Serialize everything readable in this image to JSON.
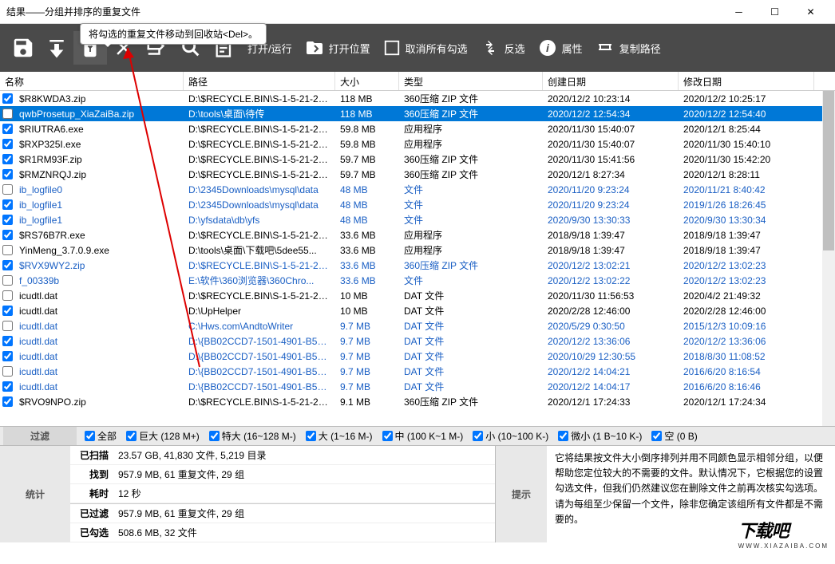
{
  "window": {
    "title": "结果——分组并排序的重复文件"
  },
  "tooltip": "将勾选的重复文件移动到回收站<Del>。",
  "toolbar": {
    "open_run": "打开/运行",
    "open_location": "打开位置",
    "deselect_all": "取消所有勾选",
    "invert": "反选",
    "properties": "属性",
    "copy_path": "复制路径"
  },
  "columns": {
    "name": "名称",
    "path": "路径",
    "size": "大小",
    "type": "类型",
    "created": "创建日期",
    "modified": "修改日期"
  },
  "rows": [
    {
      "chk": true,
      "cls": "black",
      "name": "$R8KWDA3.zip",
      "path": "D:\\$RECYCLE.BIN\\S-1-5-21-21...",
      "size": "118 MB",
      "type": "360压缩 ZIP 文件",
      "created": "2020/12/2 10:23:14",
      "modified": "2020/12/2 10:25:17"
    },
    {
      "chk": false,
      "sel": true,
      "cls": "blue",
      "name": "qwbProsetup_XiaZaiBa.zip",
      "path": "D:\\tools\\桌面\\待传",
      "size": "118 MB",
      "type": "360压缩 ZIP 文件",
      "created": "2020/12/2 12:54:34",
      "modified": "2020/12/2 12:54:40"
    },
    {
      "chk": true,
      "cls": "black",
      "name": "$RIUTRA6.exe",
      "path": "D:\\$RECYCLE.BIN\\S-1-5-21-21...",
      "size": "59.8 MB",
      "type": "应用程序",
      "created": "2020/11/30 15:40:07",
      "modified": "2020/12/1 8:25:44"
    },
    {
      "chk": true,
      "cls": "black",
      "name": "$RXP325I.exe",
      "path": "D:\\$RECYCLE.BIN\\S-1-5-21-21...",
      "size": "59.8 MB",
      "type": "应用程序",
      "created": "2020/11/30 15:40:07",
      "modified": "2020/11/30 15:40:10"
    },
    {
      "chk": true,
      "cls": "black",
      "name": "$R1RM93F.zip",
      "path": "D:\\$RECYCLE.BIN\\S-1-5-21-21...",
      "size": "59.7 MB",
      "type": "360压缩 ZIP 文件",
      "created": "2020/11/30 15:41:56",
      "modified": "2020/11/30 15:42:20"
    },
    {
      "chk": true,
      "cls": "black",
      "name": "$RMZNRQJ.zip",
      "path": "D:\\$RECYCLE.BIN\\S-1-5-21-21...",
      "size": "59.7 MB",
      "type": "360压缩 ZIP 文件",
      "created": "2020/12/1 8:27:34",
      "modified": "2020/12/1 8:28:11"
    },
    {
      "chk": false,
      "cls": "blue",
      "name": "ib_logfile0",
      "path": "D:\\2345Downloads\\mysql\\data",
      "size": "48 MB",
      "type": "文件",
      "created": "2020/11/20 9:23:24",
      "modified": "2020/11/21 8:40:42"
    },
    {
      "chk": true,
      "cls": "blue",
      "name": "ib_logfile1",
      "path": "D:\\2345Downloads\\mysql\\data",
      "size": "48 MB",
      "type": "文件",
      "created": "2020/11/20 9:23:24",
      "modified": "2019/1/26 18:26:45"
    },
    {
      "chk": true,
      "cls": "blue",
      "name": "ib_logfile1",
      "path": "D:\\yfsdata\\db\\yfs",
      "size": "48 MB",
      "type": "文件",
      "created": "2020/9/30 13:30:33",
      "modified": "2020/9/30 13:30:34"
    },
    {
      "chk": true,
      "cls": "black",
      "name": "$RS76B7R.exe",
      "path": "D:\\$RECYCLE.BIN\\S-1-5-21-21...",
      "size": "33.6 MB",
      "type": "应用程序",
      "created": "2018/9/18 1:39:47",
      "modified": "2018/9/18 1:39:47"
    },
    {
      "chk": false,
      "cls": "black",
      "name": "YinMeng_3.7.0.9.exe",
      "path": "D:\\tools\\桌面\\下载吧\\5dee55...",
      "size": "33.6 MB",
      "type": "应用程序",
      "created": "2018/9/18 1:39:47",
      "modified": "2018/9/18 1:39:47"
    },
    {
      "chk": true,
      "cls": "blue",
      "name": "$RVX9WY2.zip",
      "path": "D:\\$RECYCLE.BIN\\S-1-5-21-21...",
      "size": "33.6 MB",
      "type": "360压缩 ZIP 文件",
      "created": "2020/12/2 13:02:21",
      "modified": "2020/12/2 13:02:23"
    },
    {
      "chk": false,
      "cls": "blue",
      "name": "f_00339b",
      "path": "E:\\软件\\360浏览器\\360Chro...",
      "size": "33.6 MB",
      "type": "文件",
      "created": "2020/12/2 13:02:22",
      "modified": "2020/12/2 13:02:23"
    },
    {
      "chk": false,
      "cls": "black",
      "name": "icudtl.dat",
      "path": "D:\\$RECYCLE.BIN\\S-1-5-21-21...",
      "size": "10 MB",
      "type": "DAT 文件",
      "created": "2020/11/30 11:56:53",
      "modified": "2020/4/2 21:49:32"
    },
    {
      "chk": true,
      "cls": "black",
      "name": "icudtl.dat",
      "path": "D:\\UpHelper",
      "size": "10 MB",
      "type": "DAT 文件",
      "created": "2020/2/28 12:46:00",
      "modified": "2020/2/28 12:46:00"
    },
    {
      "chk": false,
      "cls": "blue",
      "name": "icudtl.dat",
      "path": "C:\\Hws.com\\AndtoWriter",
      "size": "9.7 MB",
      "type": "DAT 文件",
      "created": "2020/5/29 0:30:50",
      "modified": "2015/12/3 10:09:16"
    },
    {
      "chk": true,
      "cls": "blue",
      "name": "icudtl.dat",
      "path": "D:\\{BB02CCD7-1501-4901-B5E...",
      "size": "9.7 MB",
      "type": "DAT 文件",
      "created": "2020/12/2 13:36:06",
      "modified": "2020/12/2 13:36:06"
    },
    {
      "chk": true,
      "cls": "blue",
      "name": "icudtl.dat",
      "path": "D:\\{BB02CCD7-1501-4901-B5E...",
      "size": "9.7 MB",
      "type": "DAT 文件",
      "created": "2020/10/29 12:30:55",
      "modified": "2018/8/30 11:08:52"
    },
    {
      "chk": false,
      "cls": "blue",
      "name": "icudtl.dat",
      "path": "D:\\{BB02CCD7-1501-4901-B5E...",
      "size": "9.7 MB",
      "type": "DAT 文件",
      "created": "2020/12/2 14:04:21",
      "modified": "2016/6/20 8:16:54"
    },
    {
      "chk": true,
      "cls": "blue",
      "name": "icudtl.dat",
      "path": "D:\\{BB02CCD7-1501-4901-B5E...",
      "size": "9.7 MB",
      "type": "DAT 文件",
      "created": "2020/12/2 14:04:17",
      "modified": "2016/6/20 8:16:46"
    },
    {
      "chk": true,
      "cls": "black",
      "name": "$RVO9NPO.zip",
      "path": "D:\\$RECYCLE.BIN\\S-1-5-21-21...",
      "size": "9.1 MB",
      "type": "360压缩 ZIP 文件",
      "created": "2020/12/1 17:24:33",
      "modified": "2020/12/1 17:24:34"
    }
  ],
  "filters": {
    "label": "过滤",
    "all": "全部",
    "huge": "巨大",
    "huge_r": "(128 M+)",
    "xl": "特大",
    "xl_r": "(16~128 M-)",
    "large": "大",
    "large_r": "(1~16 M-)",
    "med": "中",
    "med_r": "(100 K~1 M-)",
    "small": "小",
    "small_r": "(10~100 K-)",
    "tiny": "微小",
    "tiny_r": "(1 B~10 K-)",
    "empty": "空",
    "empty_r": "(0 B)"
  },
  "stats": {
    "label": "统计",
    "scanned_k": "已扫描",
    "scanned_v": "23.57 GB, 41,830 文件, 5,219 目录",
    "found_k": "找到",
    "found_v": "957.9 MB, 61 重复文件, 29 组",
    "time_k": "耗时",
    "time_v": "12 秒",
    "filtered_k": "已过滤",
    "filtered_v": "957.9 MB, 61 重复文件, 29 组",
    "checked_k": "已勾选",
    "checked_v": "508.6 MB, 32 文件"
  },
  "hint": {
    "label": "提示",
    "text": "它将结果按文件大小倒序排列并用不同颜色显示相邻分组，以便帮助您定位较大的不需要的文件。默认情况下，它根据您的设置勾选文件，但我们仍然建议您在删除文件之前再次核实勾选项。请为每组至少保留一个文件，除非您确定该组所有文件都是不需要的。"
  },
  "watermark": "下载吧"
}
